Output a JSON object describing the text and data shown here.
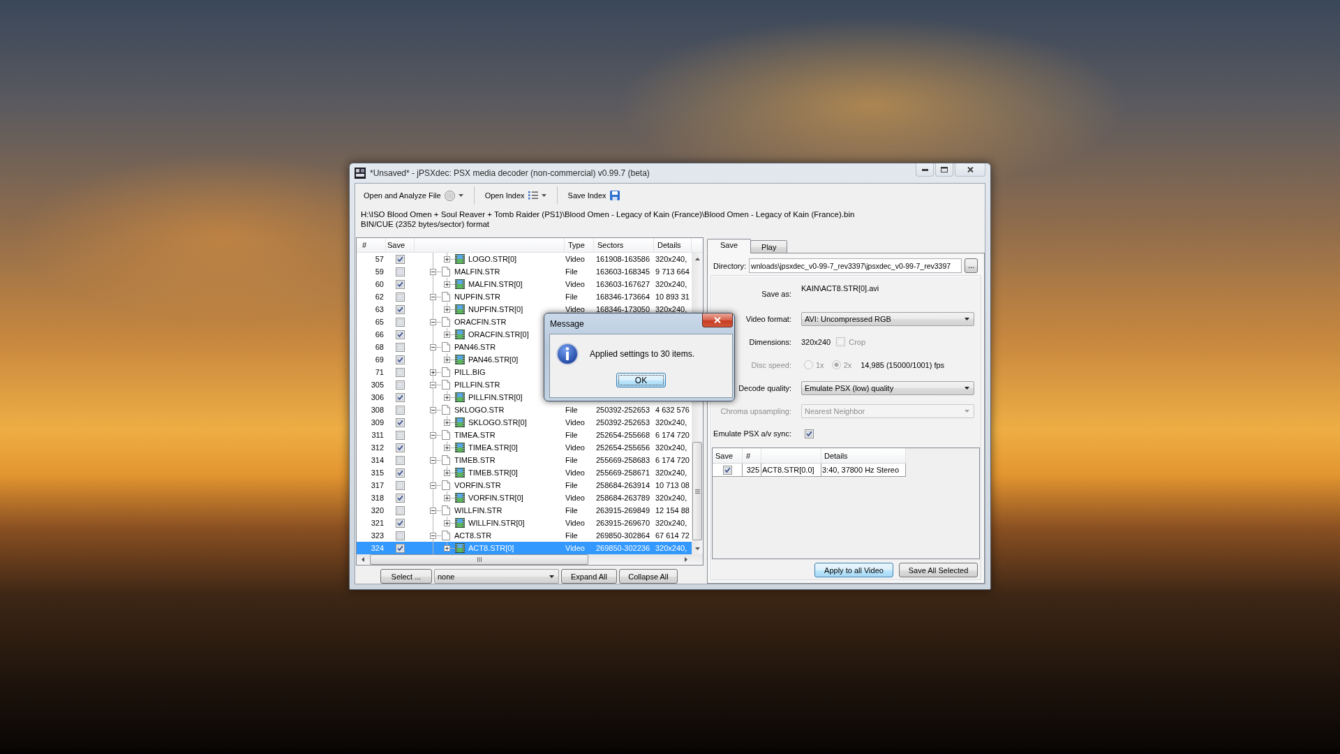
{
  "window": {
    "title": "*Unsaved* - jPSXdec: PSX media decoder (non-commercial) v0.99.7 (beta)"
  },
  "toolbar": [
    {
      "label": "Open and Analyze File",
      "kind": "disc",
      "menu": true
    },
    {
      "label": "Open Index",
      "kind": "list",
      "menu": true
    },
    {
      "label": "Save Index",
      "kind": "floppy",
      "menu": false
    }
  ],
  "source": {
    "path": "H:\\ISO Blood Omen + Soul Reaver + Tomb Raider (PS1)\\Blood Omen - Legacy of Kain (France)\\Blood Omen - Legacy of Kain (France).bin",
    "format": "BIN/CUE (2352 bytes/sector) format"
  },
  "file_table": {
    "columns": {
      "number": "#",
      "save": "Save",
      "type": "Type",
      "sectors": "Sectors",
      "details": "Details"
    },
    "rows": [
      {
        "children": [
          {
            "number": "57",
            "checked": true,
            "kind": "video",
            "name": "LOGO.STR[0]",
            "type": "Video",
            "sectors": "161908-163586",
            "details": "320x240,",
            "expanded": false,
            "selected": false
          }
        ]
      },
      {
        "number": "59",
        "checked": false,
        "kind": "file",
        "name": "MALFIN.STR",
        "type": "File",
        "sectors": "163603-168345",
        "details": "9 713 664",
        "expanded": true,
        "selected": false,
        "children": [
          {
            "number": "60",
            "checked": true,
            "kind": "video",
            "name": "MALFIN.STR[0]",
            "type": "Video",
            "sectors": "163603-167627",
            "details": "320x240,",
            "expanded": false,
            "selected": false
          }
        ]
      },
      {
        "number": "62",
        "checked": false,
        "kind": "file",
        "name": "NUPFIN.STR",
        "type": "File",
        "sectors": "168346-173664",
        "details": "10 893 31",
        "expanded": true,
        "selected": false,
        "children": [
          {
            "number": "63",
            "checked": true,
            "kind": "video",
            "name": "NUPFIN.STR[0]",
            "type": "Video",
            "sectors": "168346-173050",
            "details": "320x240,",
            "expanded": false,
            "selected": false
          }
        ]
      },
      {
        "number": "65",
        "checked": false,
        "kind": "file",
        "name": "ORACFIN.STR",
        "expanded": true,
        "selected": false,
        "children": [
          {
            "number": "66",
            "checked": true,
            "kind": "video",
            "name": "ORACFIN.STR[0]",
            "expanded": false,
            "selected": false
          }
        ]
      },
      {
        "number": "68",
        "checked": false,
        "kind": "file",
        "name": "PAN46.STR",
        "expanded": true,
        "selected": false,
        "children": [
          {
            "number": "69",
            "checked": true,
            "kind": "video",
            "name": "PAN46.STR[0]",
            "expanded": false,
            "selected": false
          }
        ]
      },
      {
        "number": "71",
        "checked": false,
        "kind": "file",
        "name": "PILL.BIG",
        "expanded": false,
        "selected": false
      },
      {
        "number": "305",
        "checked": false,
        "kind": "file",
        "name": "PILLFIN.STR",
        "expanded": true,
        "selected": false,
        "children": [
          {
            "number": "306",
            "checked": true,
            "kind": "video",
            "name": "PILLFIN.STR[0]",
            "expanded": false,
            "selected": false
          }
        ]
      },
      {
        "number": "308",
        "checked": false,
        "kind": "file",
        "name": "SKLOGO.STR",
        "type": "File",
        "sectors": "250392-252653",
        "details": "4 632 576",
        "expanded": true,
        "selected": false,
        "children": [
          {
            "number": "309",
            "checked": true,
            "kind": "video",
            "name": "SKLOGO.STR[0]",
            "type": "Video",
            "sectors": "250392-252653",
            "details": "320x240,",
            "expanded": false,
            "selected": false
          }
        ]
      },
      {
        "number": "311",
        "checked": false,
        "kind": "file",
        "name": "TIMEA.STR",
        "type": "File",
        "sectors": "252654-255668",
        "details": "6 174 720",
        "expanded": true,
        "selected": false,
        "children": [
          {
            "number": "312",
            "checked": true,
            "kind": "video",
            "name": "TIMEA.STR[0]",
            "type": "Video",
            "sectors": "252654-255656",
            "details": "320x240,",
            "expanded": false,
            "selected": false
          }
        ]
      },
      {
        "number": "314",
        "checked": false,
        "kind": "file",
        "name": "TIMEB.STR",
        "type": "File",
        "sectors": "255669-258683",
        "details": "6 174 720",
        "expanded": true,
        "selected": false,
        "children": [
          {
            "number": "315",
            "checked": true,
            "kind": "video",
            "name": "TIMEB.STR[0]",
            "type": "Video",
            "sectors": "255669-258671",
            "details": "320x240,",
            "expanded": false,
            "selected": false
          }
        ]
      },
      {
        "number": "317",
        "checked": false,
        "kind": "file",
        "name": "VORFIN.STR",
        "type": "File",
        "sectors": "258684-263914",
        "details": "10 713 08",
        "expanded": true,
        "selected": false,
        "children": [
          {
            "number": "318",
            "checked": true,
            "kind": "video",
            "name": "VORFIN.STR[0]",
            "type": "Video",
            "sectors": "258684-263789",
            "details": "320x240,",
            "expanded": false,
            "selected": false
          }
        ]
      },
      {
        "number": "320",
        "checked": false,
        "kind": "file",
        "name": "WILLFIN.STR",
        "type": "File",
        "sectors": "263915-269849",
        "details": "12 154 88",
        "expanded": true,
        "selected": false,
        "children": [
          {
            "number": "321",
            "checked": true,
            "kind": "video",
            "name": "WILLFIN.STR[0]",
            "type": "Video",
            "sectors": "263915-269670",
            "details": "320x240,",
            "expanded": false,
            "selected": false
          }
        ]
      },
      {
        "number": "323",
        "checked": false,
        "kind": "file",
        "name": "ACT8.STR",
        "type": "File",
        "sectors": "269850-302864",
        "details": "67 614 72",
        "expanded": true,
        "selected": false,
        "children": [
          {
            "number": "324",
            "checked": true,
            "kind": "video",
            "name": "ACT8.STR[0]",
            "type": "Video",
            "sectors": "269850-302236",
            "details": "320x240,",
            "expanded": false,
            "selected": true
          }
        ]
      }
    ]
  },
  "file_actions": {
    "select_button": "Select ...",
    "filter": "none",
    "expand_button": "Expand All",
    "collapse_button": "Collapse All"
  },
  "tabs": [
    {
      "label": "Save",
      "selected": true
    },
    {
      "label": "Play",
      "selected": false
    }
  ],
  "directory": {
    "label": "Directory:",
    "value": "wnloads\\jpsxdec_v0-99-7_rev3397\\jpsxdec_v0-99-7_rev3397",
    "browse_button": "..."
  },
  "settings": [
    {
      "kind": "text",
      "label": "Save as:",
      "value": "KAIN\\ACT8.STR[0].avi"
    },
    {
      "kind": "dropdown",
      "label": "Video format:",
      "value": "AVI: Uncompressed RGB",
      "disabled": false
    },
    {
      "kind": "dimensions",
      "label": "Dimensions:",
      "value": "320x240",
      "option": {
        "label": "Crop",
        "checked": false,
        "disabled": true
      }
    },
    {
      "kind": "radio",
      "label": "Disc speed:",
      "disabled": true,
      "options": [
        {
          "label": "1x",
          "selected": false
        },
        {
          "label": "2x",
          "selected": true
        }
      ],
      "value": "14,985 (15000/1001) fps"
    },
    {
      "kind": "dropdown",
      "label": "Decode quality:",
      "value": "Emulate PSX (low) quality",
      "disabled": false
    },
    {
      "kind": "dropdown",
      "label": "Chroma upsampling:",
      "value": "Nearest Neighbor",
      "disabled": true
    },
    {
      "kind": "checkbox",
      "label": "Emulate PSX a/v sync:",
      "checked": true
    }
  ],
  "audio_table": {
    "columns": {
      "save": "Save",
      "number": "#",
      "details": "Details"
    },
    "rows": [
      {
        "checked": true,
        "number": "325",
        "name": "ACT8.STR[0.0]",
        "details": "3:40, 37800 Hz Stereo"
      }
    ]
  },
  "actions": [
    {
      "label": "Apply to all Video",
      "focused": true
    },
    {
      "label": "Save All Selected",
      "focused": false
    }
  ],
  "dialog": {
    "title": "Message",
    "message": "Applied settings to 30 items.",
    "button": "OK"
  }
}
